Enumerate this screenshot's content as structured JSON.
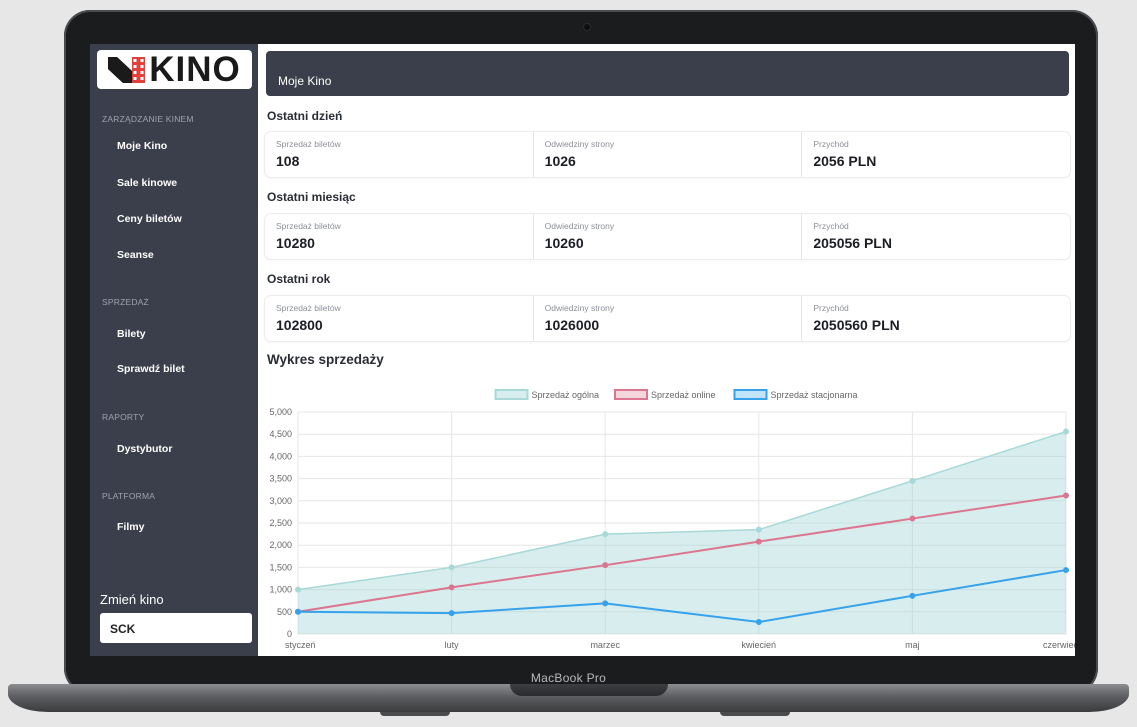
{
  "device": {
    "label": "MacBook Pro"
  },
  "app": {
    "logo_text": "KINO",
    "title": "Moje Kino"
  },
  "sidebar": {
    "sections": [
      {
        "title": "ZARZĄDZANIE KINEM",
        "items": [
          "Moje Kino",
          "Sale kinowe",
          "Ceny biletów",
          "Seanse"
        ]
      },
      {
        "title": "SPRZEDAŻ",
        "items": [
          "Bilety",
          "Sprawdź bilet"
        ]
      },
      {
        "title": "RAPORTY",
        "items": [
          "Dystybutor"
        ]
      },
      {
        "title": "PLATFORMA",
        "items": [
          "Filmy"
        ]
      }
    ],
    "change_label": "Zmień kino",
    "cinema_value": "SCK"
  },
  "stats": [
    {
      "title": "Ostatni dzień",
      "cards": [
        {
          "label": "Sprzedaż biletów",
          "value": "108"
        },
        {
          "label": "Odwiedziny strony",
          "value": "1026"
        },
        {
          "label": "Przychód",
          "value": "2056 PLN"
        }
      ]
    },
    {
      "title": "Ostatni miesiąc",
      "cards": [
        {
          "label": "Sprzedaż biletów",
          "value": "10280"
        },
        {
          "label": "Odwiedziny strony",
          "value": "10260"
        },
        {
          "label": "Przychód",
          "value": "205056 PLN"
        }
      ]
    },
    {
      "title": "Ostatni rok",
      "cards": [
        {
          "label": "Sprzedaż biletów",
          "value": "102800"
        },
        {
          "label": "Odwiedziny strony",
          "value": "1026000"
        },
        {
          "label": "Przychód",
          "value": "2050560 PLN"
        }
      ]
    }
  ],
  "chart": {
    "title": "Wykres sprzedaży"
  },
  "chart_data": {
    "type": "line",
    "categories": [
      "styczeń",
      "luty",
      "marzec",
      "kwiecień",
      "maj",
      "czerwiec"
    ],
    "ylim": [
      0,
      5000
    ],
    "yticks": [
      0,
      500,
      1000,
      1500,
      2000,
      2500,
      3000,
      3500,
      4000,
      4500,
      5000
    ],
    "ytick_labels": [
      "0",
      "500",
      "1,000",
      "1,500",
      "2,000",
      "2,500",
      "3,000",
      "3,500",
      "4,000",
      "4,500",
      "5,000"
    ],
    "grid": true,
    "legend_position": "top",
    "series": [
      {
        "name": "Sprzedaż ogólna",
        "values": [
          1000,
          1500,
          2250,
          2350,
          3450,
          4560
        ],
        "color": "#a8d8d8",
        "fill": true
      },
      {
        "name": "Sprzedaż online",
        "values": [
          500,
          1050,
          1550,
          2080,
          2600,
          3120
        ],
        "color": "#dc7690",
        "fill": false
      },
      {
        "name": "Sprzedaż stacjonarna",
        "values": [
          500,
          470,
          690,
          270,
          860,
          1440
        ],
        "color": "#36a2eb",
        "fill": false
      }
    ]
  }
}
